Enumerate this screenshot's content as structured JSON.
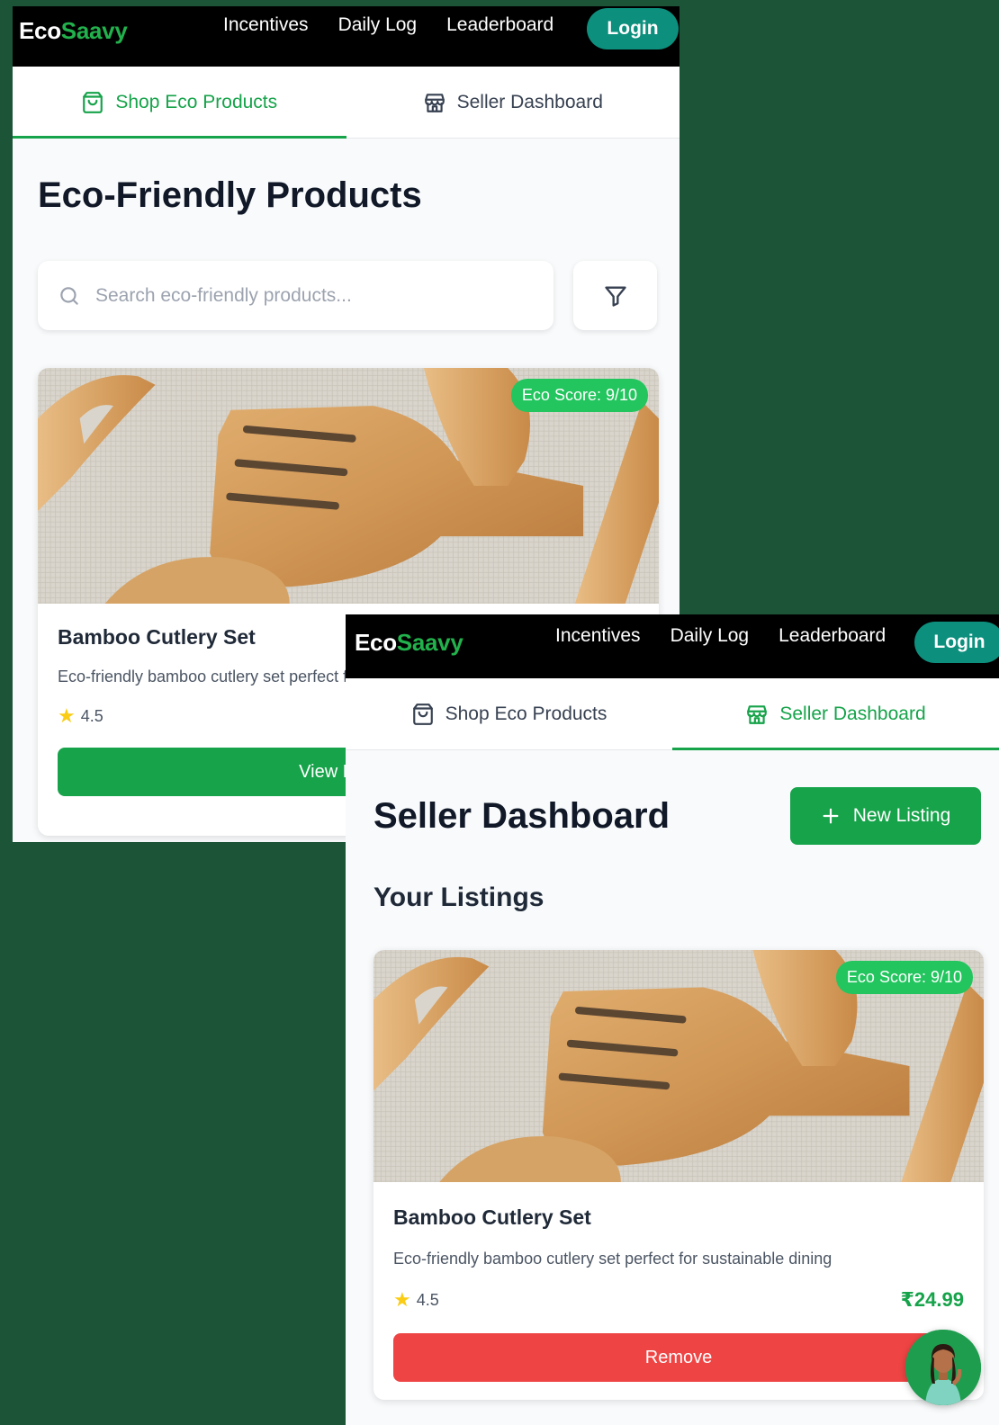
{
  "brand": {
    "eco": "Eco",
    "saavy": "Saavy"
  },
  "nav": {
    "links": [
      "Incentives",
      "Daily Log",
      "Leaderboard"
    ],
    "login": "Login"
  },
  "tabs": {
    "shop": "Shop Eco Products",
    "seller": "Seller Dashboard"
  },
  "shop_screen": {
    "title": "Eco-Friendly Products",
    "search_placeholder": "Search eco-friendly products...",
    "product": {
      "eco_score": "Eco Score: 9/10",
      "name": "Bamboo Cutlery Set",
      "description": "Eco-friendly bamboo cutlery set perfect for sustainable dining",
      "rating": "4.5",
      "button": "View Details"
    }
  },
  "seller_screen": {
    "title": "Seller Dashboard",
    "new_listing": "New Listing",
    "section": "Your Listings",
    "product": {
      "eco_score": "Eco Score: 9/10",
      "name": "Bamboo Cutlery Set",
      "description": "Eco-friendly bamboo cutlery set perfect for sustainable dining",
      "rating": "4.5",
      "price": "₹24.99",
      "button": "Remove"
    }
  },
  "colors": {
    "background": "#1c5438",
    "brand_green": "#22b14c",
    "login_teal": "#0d8f7d",
    "primary_green": "#16a34a",
    "eco_badge": "#22c55e",
    "remove_red": "#ef4444",
    "star": "#facc15"
  },
  "icons": {
    "shop_tab": "shopping-bag-icon",
    "seller_tab": "store-icon",
    "search": "search-icon",
    "filter": "filter-icon",
    "star": "star-icon",
    "plus": "plus-icon"
  }
}
